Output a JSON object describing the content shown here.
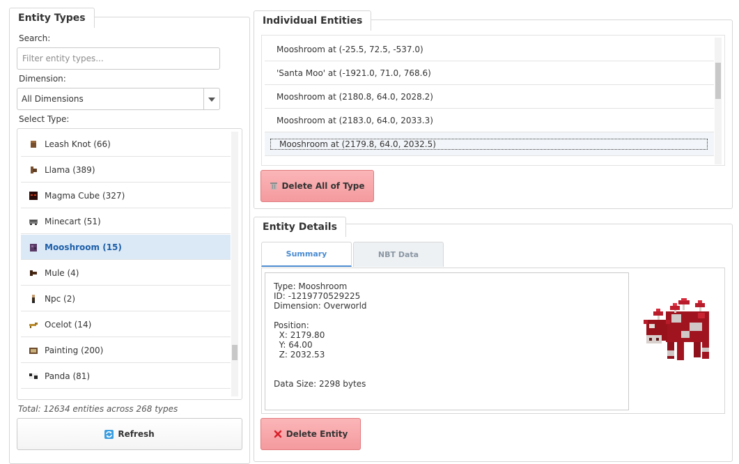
{
  "entity_types": {
    "title": "Entity Types",
    "search_label": "Search:",
    "search_placeholder": "Filter entity types...",
    "dimension_label": "Dimension:",
    "dimension_value": "All Dimensions",
    "select_label": "Select Type:",
    "items": [
      {
        "label": "Leash Knot (66)",
        "icon": "leash-knot-icon"
      },
      {
        "label": "Llama (389)",
        "icon": "llama-icon"
      },
      {
        "label": "Magma Cube (327)",
        "icon": "magma-cube-icon"
      },
      {
        "label": "Minecart (51)",
        "icon": "minecart-icon"
      },
      {
        "label": "Mooshroom (15)",
        "icon": "mooshroom-icon"
      },
      {
        "label": "Mule (4)",
        "icon": "mule-icon"
      },
      {
        "label": "Npc (2)",
        "icon": "npc-icon"
      },
      {
        "label": "Ocelot (14)",
        "icon": "ocelot-icon"
      },
      {
        "label": "Painting (200)",
        "icon": "painting-icon"
      },
      {
        "label": "Panda (81)",
        "icon": "panda-icon"
      }
    ],
    "total": "Total: 12634 entities across 268 types",
    "refresh_label": "Refresh"
  },
  "individual_entities": {
    "title": "Individual Entities",
    "items": [
      "Mooshroom at (-25.5, 72.5, -537.0)",
      "'Santa Moo' at (-1921.0, 71.0, 768.6)",
      "Mooshroom at (2180.8, 64.0, 2028.2)",
      "Mooshroom at (2183.0, 64.0, 2033.3)",
      "Mooshroom at (2179.8, 64.0, 2032.5)"
    ],
    "delete_all_label": "Delete All of Type"
  },
  "entity_details": {
    "title": "Entity Details",
    "tabs": [
      "Summary",
      "NBT Data"
    ],
    "summary": {
      "type": "Type: Mooshroom",
      "id": "ID: -1219770529225",
      "dimension": "Dimension: Overworld",
      "position_label": "Position:",
      "x": "  X: 2179.80",
      "y": "  Y: 64.00",
      "z": "  Z: 2032.53",
      "data_size": "Data Size: 2298 bytes"
    },
    "delete_label": "Delete Entity"
  },
  "colors": {
    "accent": "#4a8bd0",
    "selected_row": "#dbe9f7",
    "danger_button": "#f49a9e"
  }
}
